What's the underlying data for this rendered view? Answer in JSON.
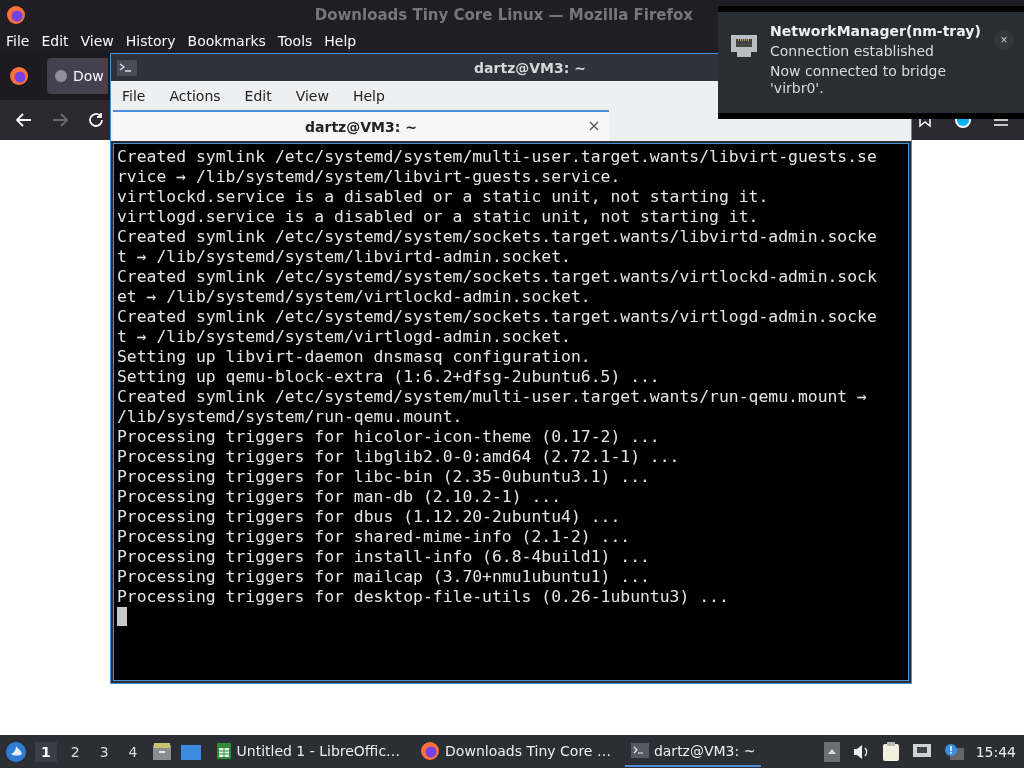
{
  "browser": {
    "title": "Downloads Tiny Core Linux — Mozilla Firefox",
    "menu": [
      "File",
      "Edit",
      "View",
      "History",
      "Bookmarks",
      "Tools",
      "Help"
    ],
    "tab": {
      "label": "Dow"
    }
  },
  "terminal": {
    "title": "dartz@VM3: ~",
    "menu": [
      "File",
      "Actions",
      "Edit",
      "View",
      "Help"
    ],
    "tabs": [
      {
        "label": "dartz@VM3: ~",
        "selected": true
      }
    ],
    "lines": [
      "Created symlink /etc/systemd/system/multi-user.target.wants/libvirt-guests.se",
      "rvice → /lib/systemd/system/libvirt-guests.service.",
      "virtlockd.service is a disabled or a static unit, not starting it.",
      "virtlogd.service is a disabled or a static unit, not starting it.",
      "Created symlink /etc/systemd/system/sockets.target.wants/libvirtd-admin.socke",
      "t → /lib/systemd/system/libvirtd-admin.socket.",
      "Created symlink /etc/systemd/system/sockets.target.wants/virtlockd-admin.sock",
      "et → /lib/systemd/system/virtlockd-admin.socket.",
      "Created symlink /etc/systemd/system/sockets.target.wants/virtlogd-admin.socke",
      "t → /lib/systemd/system/virtlogd-admin.socket.",
      "Setting up libvirt-daemon dnsmasq configuration.",
      "Setting up qemu-block-extra (1:6.2+dfsg-2ubuntu6.5) ...",
      "Created symlink /etc/systemd/system/multi-user.target.wants/run-qemu.mount →",
      "/lib/systemd/system/run-qemu.mount.",
      "Processing triggers for hicolor-icon-theme (0.17-2) ...",
      "Processing triggers for libglib2.0-0:amd64 (2.72.1-1) ...",
      "Processing triggers for libc-bin (2.35-0ubuntu3.1) ...",
      "Processing triggers for man-db (2.10.2-1) ...",
      "Processing triggers for dbus (1.12.20-2ubuntu4) ...",
      "Processing triggers for shared-mime-info (2.1-2) ...",
      "Processing triggers for install-info (6.8-4build1) ...",
      "Processing triggers for mailcap (3.70+nmu1ubuntu1) ...",
      "Processing triggers for desktop-file-utils (0.26-1ubuntu3) ..."
    ]
  },
  "notification": {
    "title": "NetworkManager(nm-tray)",
    "summary": "Connection established",
    "body": "Now connected to bridge 'virbr0'.",
    "close": "×"
  },
  "taskbar": {
    "workspaces": [
      {
        "label": "1",
        "selected": true
      },
      {
        "label": "2",
        "selected": false
      },
      {
        "label": "3",
        "selected": false
      },
      {
        "label": "4",
        "selected": false
      }
    ],
    "tasks": [
      {
        "label": "Untitled 1 - LibreOffic…",
        "kind": "office",
        "selected": false
      },
      {
        "label": "Downloads Tiny Core …",
        "kind": "browser",
        "selected": false
      },
      {
        "label": "dartz@VM3: ~",
        "kind": "terminal",
        "selected": true
      }
    ],
    "clock": "15:44"
  }
}
